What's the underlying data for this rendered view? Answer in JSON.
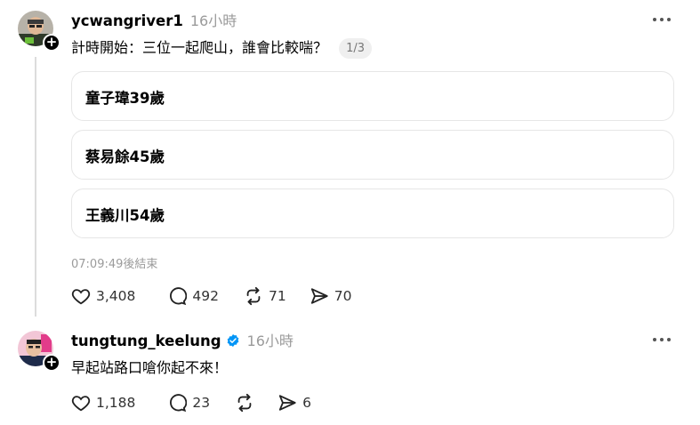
{
  "post1": {
    "username": "ycwangriver1",
    "timestamp": "16小時",
    "text": "計時開始：三位一起爬山，誰會比較喘？",
    "page_indicator": "1/3",
    "poll": {
      "options": [
        "童子瑋39歲",
        "蔡易餘45歲",
        "王義川54歲"
      ],
      "status": "07:09:49後結束"
    },
    "actions": {
      "likes": "3,408",
      "comments": "492",
      "reposts": "71",
      "shares": "70"
    }
  },
  "post2": {
    "username": "tungtung_keelung",
    "verified": true,
    "timestamp": "16小時",
    "text": "早起站路口嗆你起不來！",
    "actions": {
      "likes": "1,188",
      "comments": "23",
      "reposts": "",
      "shares": "6"
    }
  },
  "icons": {
    "like": "heart-icon",
    "comment": "comment-bubble-icon",
    "repost": "repost-icon",
    "share": "send-icon",
    "more": "more-dots-icon",
    "follow": "plus-icon",
    "verified": "verified-badge-icon"
  },
  "colors": {
    "verified": "#0095f6",
    "muted": "#9b9b9b",
    "border": "#e6e6e6"
  }
}
